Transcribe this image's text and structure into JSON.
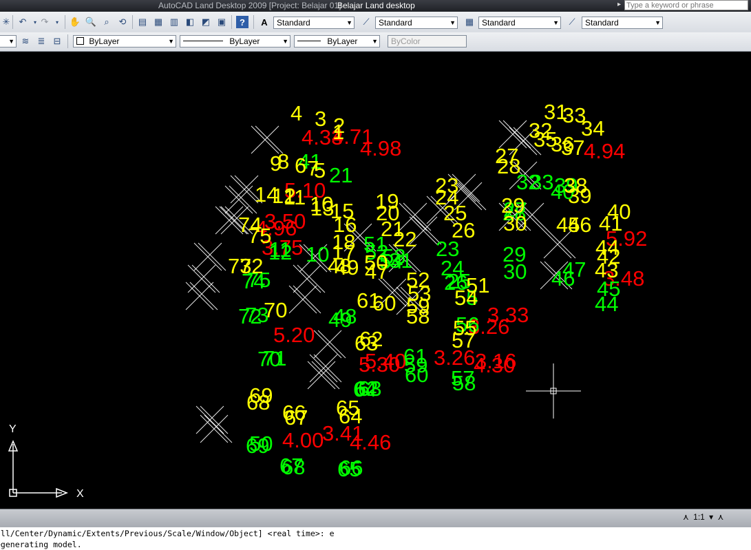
{
  "title_bar": {
    "app_title": "AutoCAD Land Desktop 2009 [Project: Belajar 01]",
    "document_title": "Belajar Land desktop"
  },
  "search": {
    "placeholder": "Type a keyword or phrase",
    "arrow_icon": "triangle-right-icon"
  },
  "toolbar1": {
    "icons": [
      "new-icon",
      "undo-icon",
      "undo-dropdown-icon",
      "redo-icon",
      "redo-dropdown-icon",
      "pan-icon",
      "zoom-realtime-icon",
      "zoom-window-icon",
      "zoom-previous-icon",
      "properties-icon",
      "design-center-icon",
      "tool-palettes-icon",
      "sheet-set-icon",
      "markup-icon",
      "calc-icon",
      "help-icon"
    ],
    "text_style_value": "Standard",
    "dim_style_value": "Standard",
    "table_style_value": "Standard",
    "multileader_style_value": "Standard"
  },
  "toolbar2": {
    "icons": [
      "layer-manager-icon",
      "layer-previous-icon",
      "layer-state-icon"
    ],
    "color_value": "ByLayer",
    "linetype_value": "ByLayer",
    "lineweight_value": "ByLayer",
    "plotstyle_value": "ByColor"
  },
  "drawing": {
    "background": "#000000",
    "colors": {
      "yellow": "#ffff00",
      "red": "#ff0000",
      "green": "#00ff00",
      "white": "#ffffff"
    },
    "point_labels": {
      "yellow": [
        "4",
        "3",
        "2",
        "1",
        "9",
        "8",
        "6",
        "7",
        "5",
        "14",
        "12",
        "11",
        "10",
        "19",
        "20",
        "15",
        "16",
        "21",
        "22",
        "18",
        "17",
        "74",
        "75",
        "73",
        "72",
        "13",
        "48",
        "49",
        "50",
        "70",
        "52",
        "53",
        "61",
        "60",
        "62",
        "63",
        "23",
        "24",
        "25",
        "26",
        "27",
        "28",
        "29",
        "30",
        "31",
        "32",
        "33",
        "34",
        "35",
        "36",
        "37",
        "38",
        "39",
        "40",
        "41",
        "42",
        "43",
        "44",
        "45",
        "46",
        "47",
        "51",
        "54",
        "55",
        "57",
        "58",
        "59",
        "64",
        "65",
        "66",
        "67",
        "68",
        "69"
      ],
      "green": [
        "41",
        "74",
        "75",
        "72",
        "73",
        "70",
        "71",
        "21",
        "11",
        "12",
        "10",
        "49",
        "48",
        "46",
        "47",
        "45",
        "44",
        "29",
        "30",
        "23",
        "24",
        "25",
        "26",
        "27",
        "28",
        "55",
        "56",
        "57",
        "58",
        "59",
        "60",
        "61",
        "62",
        "63",
        "64",
        "65",
        "66",
        "67",
        "68",
        "69",
        "50",
        "51",
        "52",
        "53",
        "54",
        "31",
        "32",
        "33",
        "40",
        "39"
      ],
      "red": [
        "4.33",
        "4.71",
        "4.98",
        "4.96",
        "3.41",
        "4.46",
        "4.00",
        "5.20",
        "5.30",
        "4.30",
        "3.33",
        "3.26",
        "3.16",
        "3.26",
        "5.10",
        "4.94",
        "5.40",
        "3.50",
        "5.92",
        "3.75",
        "3.48"
      ]
    },
    "ucs_x": "X",
    "ucs_y": "Y"
  },
  "status_bar": {
    "annotation_scale": "1:1",
    "annotation_scale_icon": "annotation-scale-icon",
    "dropdown_icon": "chevron-down-icon",
    "visibility_icon": "annotation-visibility-icon"
  },
  "command_line": {
    "line1": "all/Center/Dynamic/Extents/Previous/Scale/Window/Object] <real time>: e",
    "line2": "egenerating model."
  }
}
